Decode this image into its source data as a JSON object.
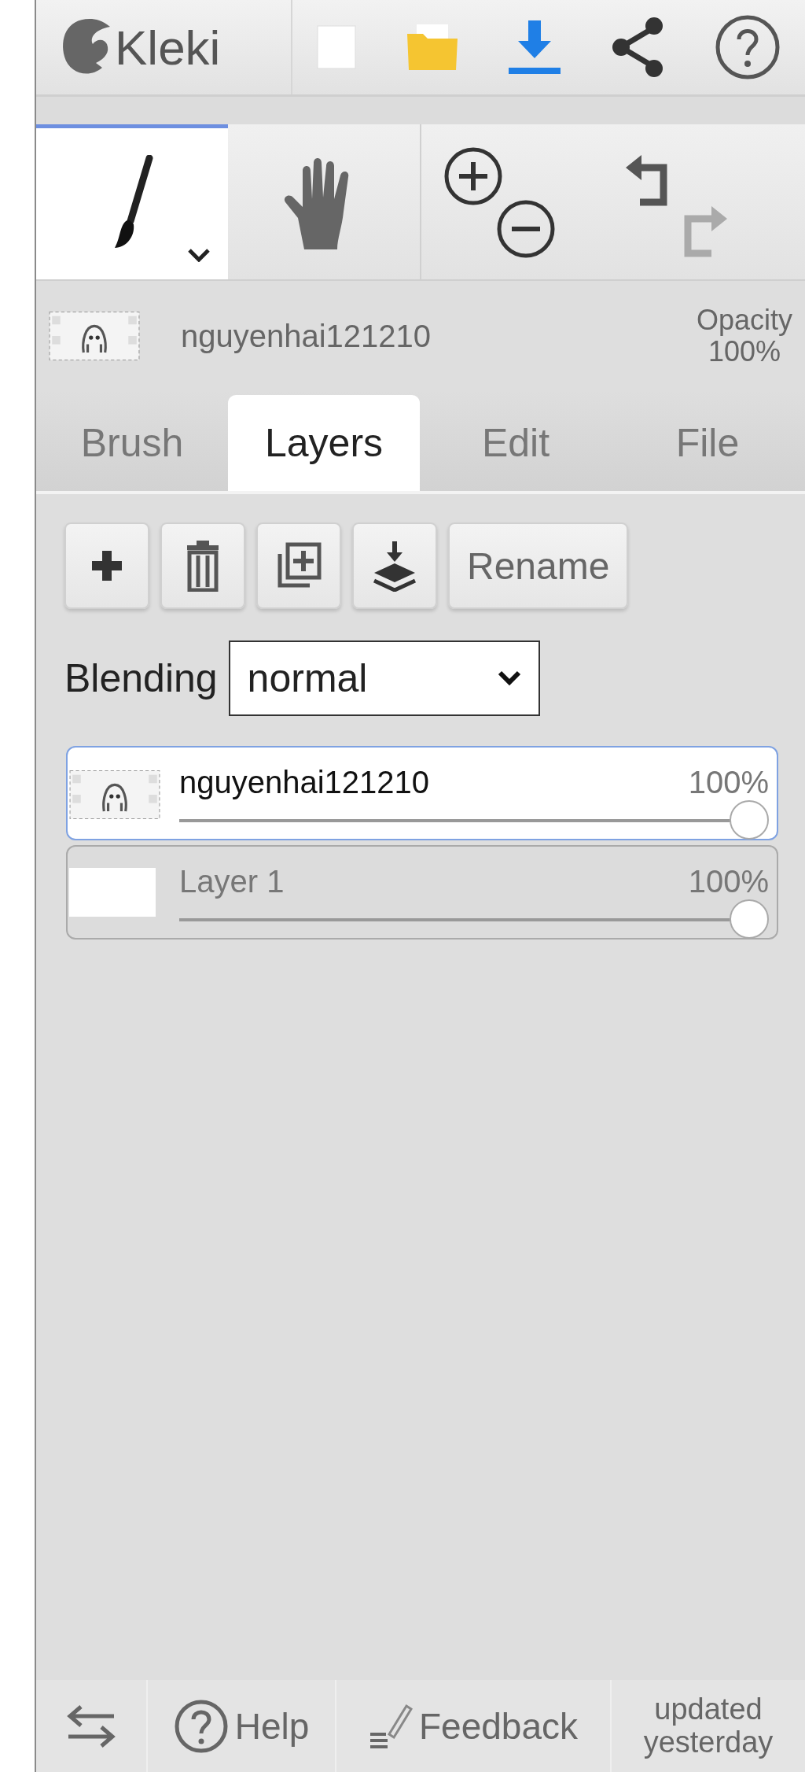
{
  "header": {
    "logo": "Kleki"
  },
  "tools": [
    {
      "kind": "brush",
      "selected": true
    },
    {
      "kind": "hand",
      "selected": false
    }
  ],
  "history": [
    {
      "kind": "undo",
      "disabled": false
    },
    {
      "kind": "redo",
      "disabled": true
    }
  ],
  "current_layer": {
    "name": "nguyenhai121210",
    "opacity_label": "Opacity",
    "opacity": "100%"
  },
  "tabs": [
    {
      "label": "Brush",
      "selected": false
    },
    {
      "label": "Layers",
      "selected": true
    },
    {
      "label": "Edit",
      "selected": false
    },
    {
      "label": "File",
      "selected": false
    }
  ],
  "layer_actions": [
    {
      "kind": "add"
    },
    {
      "kind": "delete"
    },
    {
      "kind": "duplicate"
    },
    {
      "kind": "merge"
    },
    {
      "kind": "text",
      "label": "Rename"
    }
  ],
  "blending": {
    "label": "Blending",
    "value": "normal"
  },
  "layers": [
    {
      "name": "nguyenhai121210",
      "opacity": "100%",
      "level": 1,
      "selected": true,
      "kind": "figure"
    },
    {
      "name": "Layer 1",
      "opacity": "100%",
      "level": 1,
      "selected": false,
      "kind": "blank"
    }
  ],
  "footer": [
    {
      "kind": "swap"
    },
    {
      "kind": "help",
      "label": "Help"
    },
    {
      "kind": "feedback",
      "label": "Feedback"
    },
    {
      "kind": "status",
      "label": "updated yesterday"
    }
  ]
}
